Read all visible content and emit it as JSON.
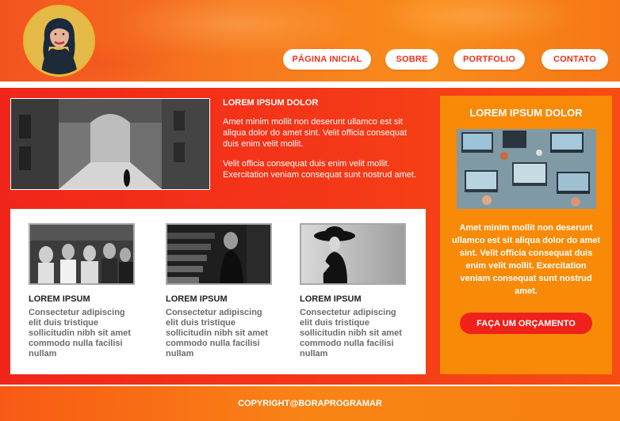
{
  "header": {
    "nav": [
      {
        "label": "PÁGINA INICIAL"
      },
      {
        "label": "SOBRE"
      },
      {
        "label": "PORTFOLIO"
      },
      {
        "label": "CONTATO"
      }
    ]
  },
  "feature": {
    "title": "LOREM IPSUM DOLOR",
    "paragraph1": "Amet minim mollit non deserunt ullamco est sit aliqua dolor do amet sint. Velit officia consequat duis enim velit mollit.",
    "paragraph2": "Velit officia consequat duis enim velit mollit. Exercitation veniam consequat sunt nostrud amet."
  },
  "cards": [
    {
      "title": "LOREM IPSUM",
      "text": "Consectetur adipiscing elit duis tristique sollicitudin nibh sit amet commodo nulla facilisi nullam"
    },
    {
      "title": "LOREM IPSUM",
      "text": "Consectetur adipiscing elit duis tristique sollicitudin nibh sit amet commodo nulla facilisi nullam"
    },
    {
      "title": "LOREM IPSUM",
      "text": "Consectetur adipiscing elit duis tristique sollicitudin nibh sit amet commodo nulla facilisi nullam"
    }
  ],
  "sidebar": {
    "title": "LOREM IPSUM DOLOR",
    "text": "Amet minim mollit non deserunt ullamco est sit aliqua dolor do amet sint. Velit officia consequat duis enim velit mollit. Exercitation veniam consequat sunt nostrud amet.",
    "button": "FAÇA UM ORÇAMENTO"
  },
  "footer": {
    "copyright": "COPYRIGHT@BORAPROGRAMAR"
  },
  "colors": {
    "accent_red": "#f0261a",
    "accent_orange": "#f98a08",
    "nav_text": "#f0301c"
  }
}
